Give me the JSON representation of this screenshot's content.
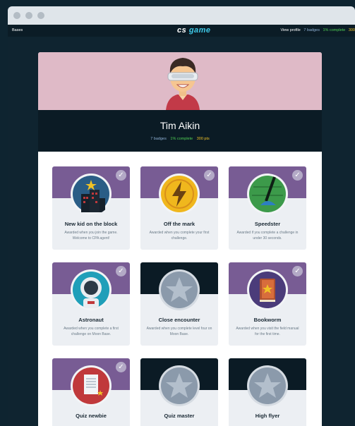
{
  "nav": {
    "left_link": "Bases",
    "brand_cs": "cs",
    "brand_game": "game",
    "view_profile": "View profile",
    "badges": "7 badges",
    "complete": "1% complete",
    "points": "300"
  },
  "profile": {
    "name": "Tim Aikin",
    "badges": "7 badges",
    "complete": "1% complete",
    "points": "300 pts"
  },
  "colors": {
    "accent": "#785c94",
    "locked": "#0b1b25",
    "complete": "#4fcf54",
    "points": "#f0c226"
  },
  "badges": [
    {
      "title": "New kid on the block",
      "desc": "Awarded when you join the game. Welcome to CPA agent!",
      "earned": true,
      "icon": "city-star-icon"
    },
    {
      "title": "Off the mark",
      "desc": "Awarded when you complete your first challenge.",
      "earned": true,
      "icon": "lightning-icon"
    },
    {
      "title": "Speedster",
      "desc": "Awarded if you complete a challenge in under 30 seconds.",
      "earned": true,
      "icon": "stopwatch-icon"
    },
    {
      "title": "Astronaut",
      "desc": "Awarded when you complete a first challenge on Moon Base.",
      "earned": true,
      "icon": "astronaut-icon"
    },
    {
      "title": "Close encounter",
      "desc": "Awarded when you complete level four on Moon Base.",
      "earned": false,
      "icon": "star-icon"
    },
    {
      "title": "Bookworm",
      "desc": "Awarded when you visit the field manual for the first time.",
      "earned": true,
      "icon": "book-icon"
    },
    {
      "title": "Quiz newbie",
      "desc": "",
      "earned": true,
      "icon": "quiz-paper-icon"
    },
    {
      "title": "Quiz master",
      "desc": "",
      "earned": false,
      "icon": "star-icon"
    },
    {
      "title": "High flyer",
      "desc": "",
      "earned": false,
      "icon": "star-icon"
    }
  ]
}
